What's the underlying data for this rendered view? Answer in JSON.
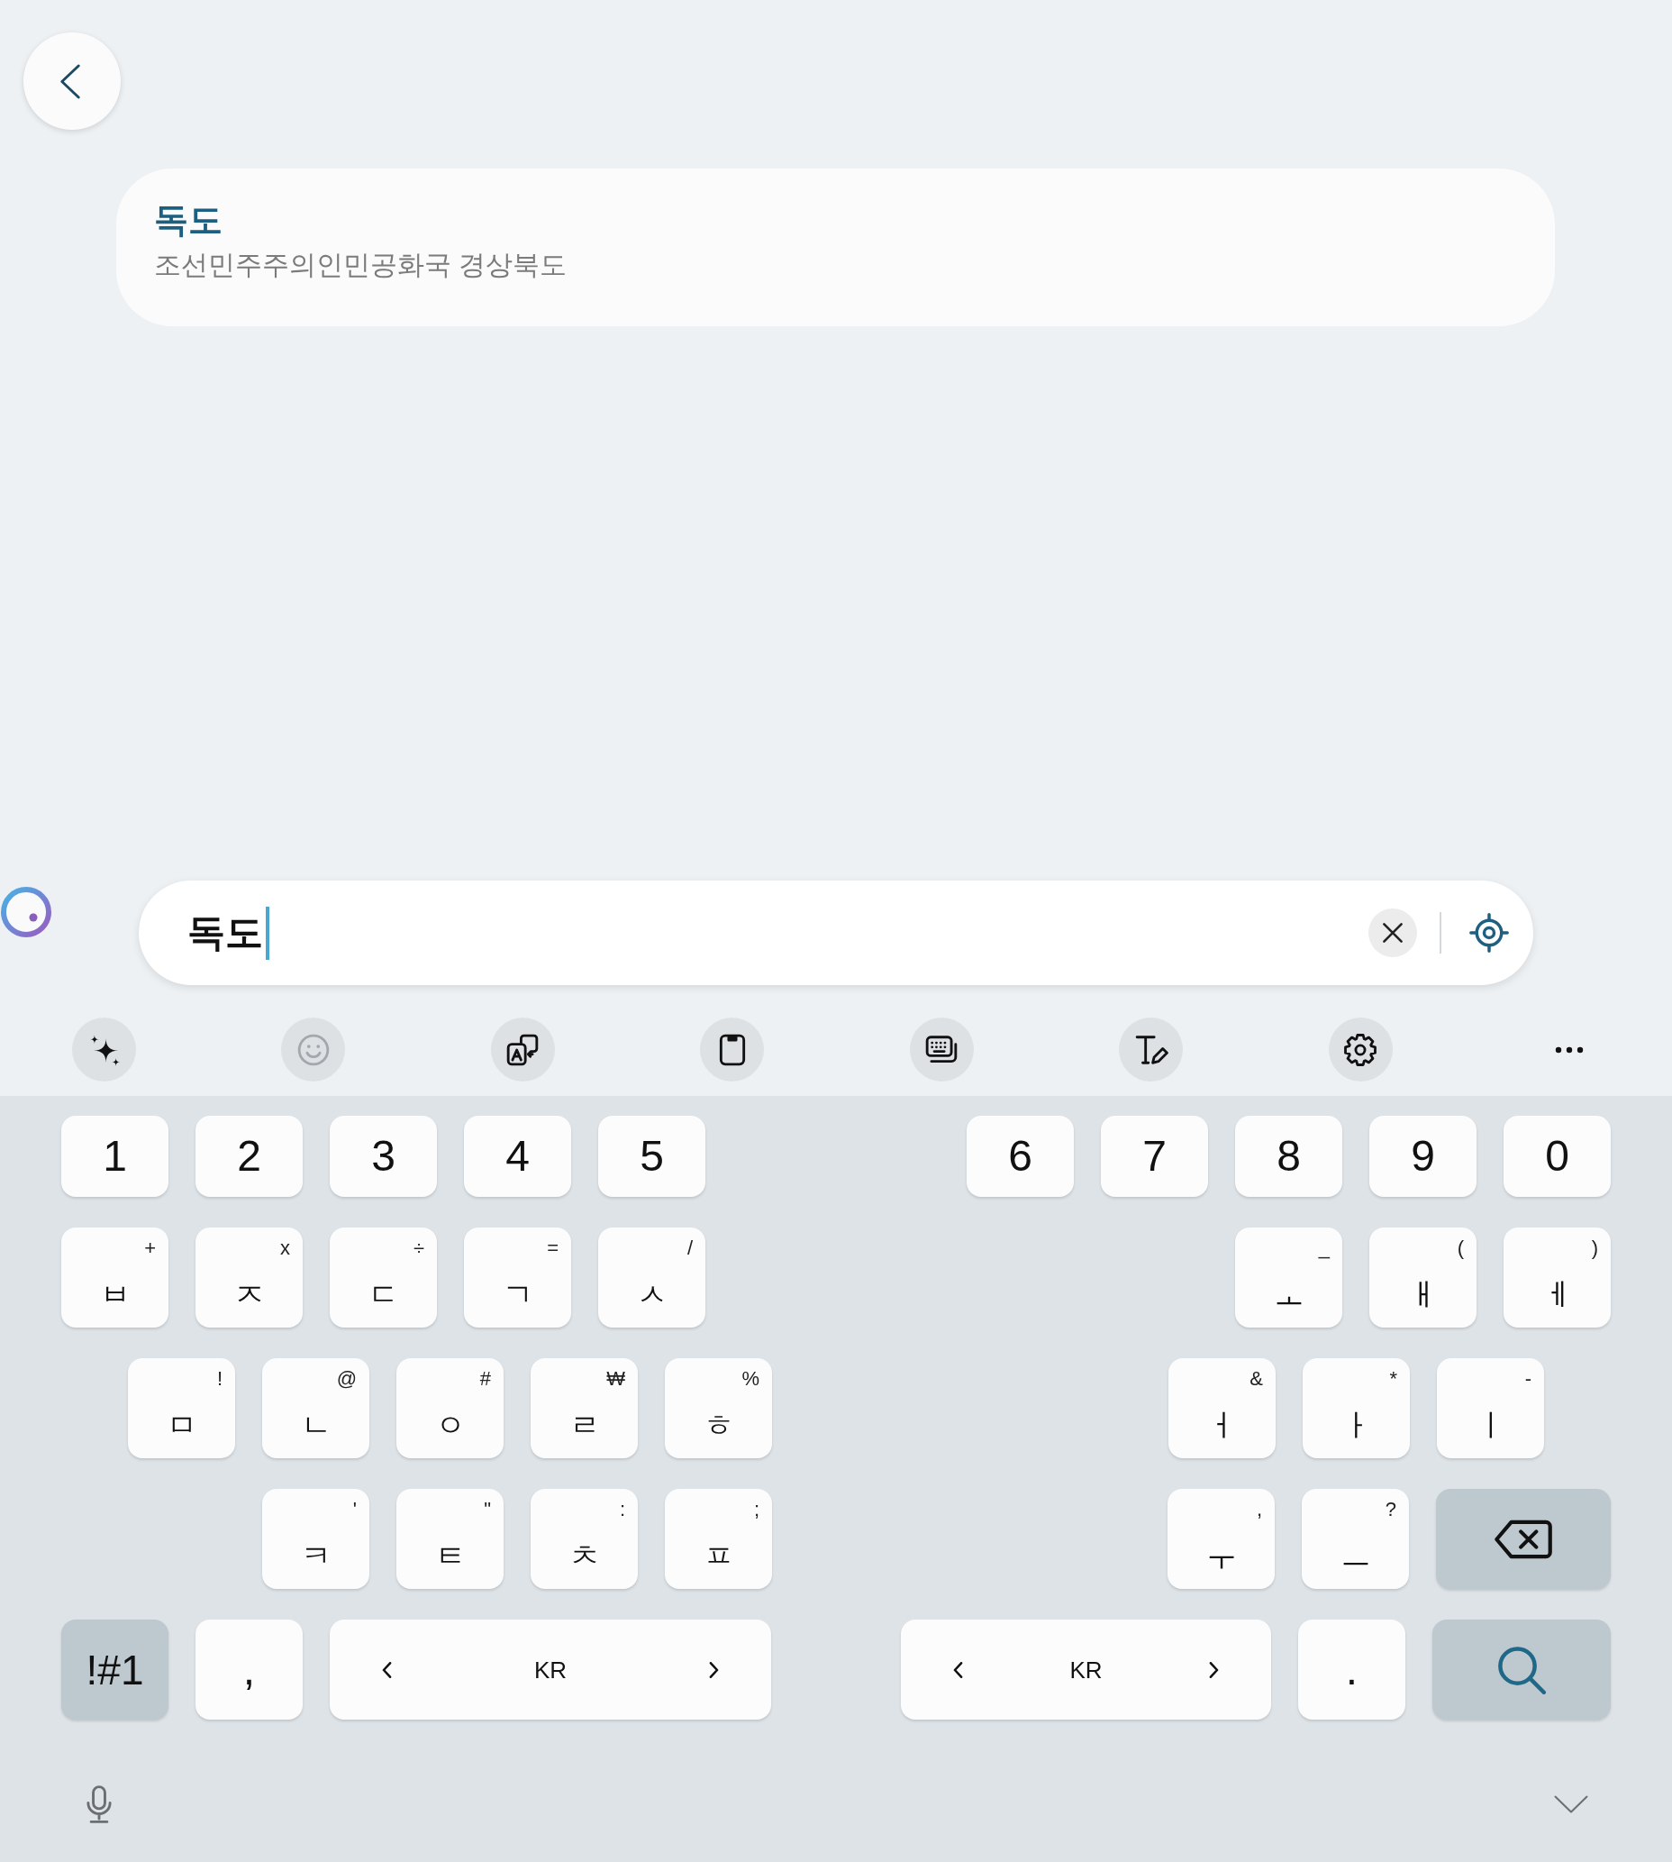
{
  "result_card": {
    "title": "독도",
    "address": "조선민주주의인민공화국 경상북도"
  },
  "search": {
    "value": "독도",
    "focused": true
  },
  "toolbar": [
    {
      "kind": "ai",
      "disabled": false
    },
    {
      "kind": "emoji",
      "disabled": true
    },
    {
      "kind": "translate",
      "disabled": false
    },
    {
      "kind": "clipboard",
      "disabled": false
    },
    {
      "kind": "keyboard_mode",
      "disabled": false
    },
    {
      "kind": "handwriting",
      "disabled": false
    },
    {
      "kind": "settings",
      "disabled": false
    },
    {
      "kind": "more",
      "disabled": false
    }
  ],
  "keyboard": {
    "rows": [
      {
        "left": [
          {
            "kind": "char",
            "label": "1"
          },
          {
            "kind": "char",
            "label": "2"
          },
          {
            "kind": "char",
            "label": "3"
          },
          {
            "kind": "char",
            "label": "4"
          },
          {
            "kind": "char",
            "label": "5"
          }
        ],
        "right": [
          {
            "kind": "char",
            "label": "6"
          },
          {
            "kind": "char",
            "label": "7"
          },
          {
            "kind": "char",
            "label": "8"
          },
          {
            "kind": "char",
            "label": "9"
          },
          {
            "kind": "char",
            "label": "0"
          }
        ]
      },
      {
        "left": [
          {
            "kind": "char",
            "label": "ㅂ",
            "symbol": "+"
          },
          {
            "kind": "char",
            "label": "ㅈ",
            "symbol": "x"
          },
          {
            "kind": "char",
            "label": "ㄷ",
            "symbol": "÷"
          },
          {
            "kind": "char",
            "label": "ㄱ",
            "symbol": "="
          },
          {
            "kind": "char",
            "label": "ㅅ",
            "symbol": "/"
          }
        ],
        "right": [
          {
            "kind": "char",
            "label": "ㅗ",
            "symbol": "_"
          },
          {
            "kind": "char",
            "label": "ㅐ",
            "symbol": "("
          },
          {
            "kind": "char",
            "label": "ㅔ",
            "symbol": ")"
          }
        ]
      },
      {
        "left": [
          {
            "kind": "char",
            "label": "ㅁ",
            "symbol": "!"
          },
          {
            "kind": "char",
            "label": "ㄴ",
            "symbol": "@"
          },
          {
            "kind": "char",
            "label": "ㅇ",
            "symbol": "#"
          },
          {
            "kind": "char",
            "label": "ㄹ",
            "symbol": "₩"
          },
          {
            "kind": "char",
            "label": "ㅎ",
            "symbol": "%"
          }
        ],
        "right": [
          {
            "kind": "char",
            "label": "ㅓ",
            "symbol": "&"
          },
          {
            "kind": "char",
            "label": "ㅏ",
            "symbol": "*"
          },
          {
            "kind": "char",
            "label": "ㅣ",
            "symbol": "-"
          }
        ]
      },
      {
        "left": [
          {
            "kind": "char",
            "label": "ㅋ",
            "symbol": "'"
          },
          {
            "kind": "char",
            "label": "ㅌ",
            "symbol": "\""
          },
          {
            "kind": "char",
            "label": "ㅊ",
            "symbol": ":"
          },
          {
            "kind": "char",
            "label": "ㅍ",
            "symbol": ";"
          }
        ],
        "right": [
          {
            "kind": "char",
            "label": "ㅜ",
            "symbol": ","
          },
          {
            "kind": "char",
            "label": "ㅡ",
            "symbol": "?"
          },
          {
            "kind": "backspace"
          }
        ]
      },
      {
        "left": [
          {
            "kind": "mode",
            "label": "!#1"
          },
          {
            "kind": "char",
            "label": ","
          },
          {
            "kind": "space",
            "label": "KR"
          }
        ],
        "right": [
          {
            "kind": "space",
            "label": "KR"
          },
          {
            "kind": "char",
            "label": "."
          },
          {
            "kind": "search"
          }
        ]
      }
    ]
  }
}
